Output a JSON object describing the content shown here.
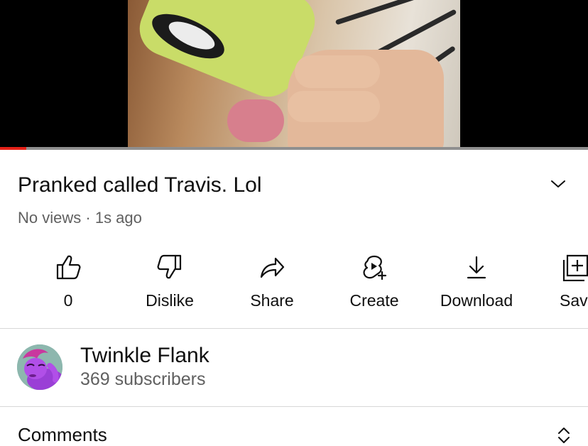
{
  "video": {
    "title": "Pranked called Travis. Lol",
    "views": "No views",
    "separator": "·",
    "age": "1s ago",
    "progress_fraction": 0.045
  },
  "actions": [
    {
      "id": "like",
      "label": "0",
      "icon": "thumbs-up-icon"
    },
    {
      "id": "dislike",
      "label": "Dislike",
      "icon": "thumbs-down-icon"
    },
    {
      "id": "share",
      "label": "Share",
      "icon": "share-arrow-icon"
    },
    {
      "id": "create",
      "label": "Create",
      "icon": "create-remix-icon"
    },
    {
      "id": "download",
      "label": "Download",
      "icon": "download-icon"
    },
    {
      "id": "save",
      "label": "Sav",
      "icon": "save-playlist-icon"
    }
  ],
  "channel": {
    "name": "Twinkle Flank",
    "subscribers": "369 subscribers"
  },
  "comments": {
    "heading": "Comments"
  },
  "colors": {
    "progress": "#e62117",
    "text_primary": "#0f0f0f",
    "text_secondary": "#606060"
  }
}
